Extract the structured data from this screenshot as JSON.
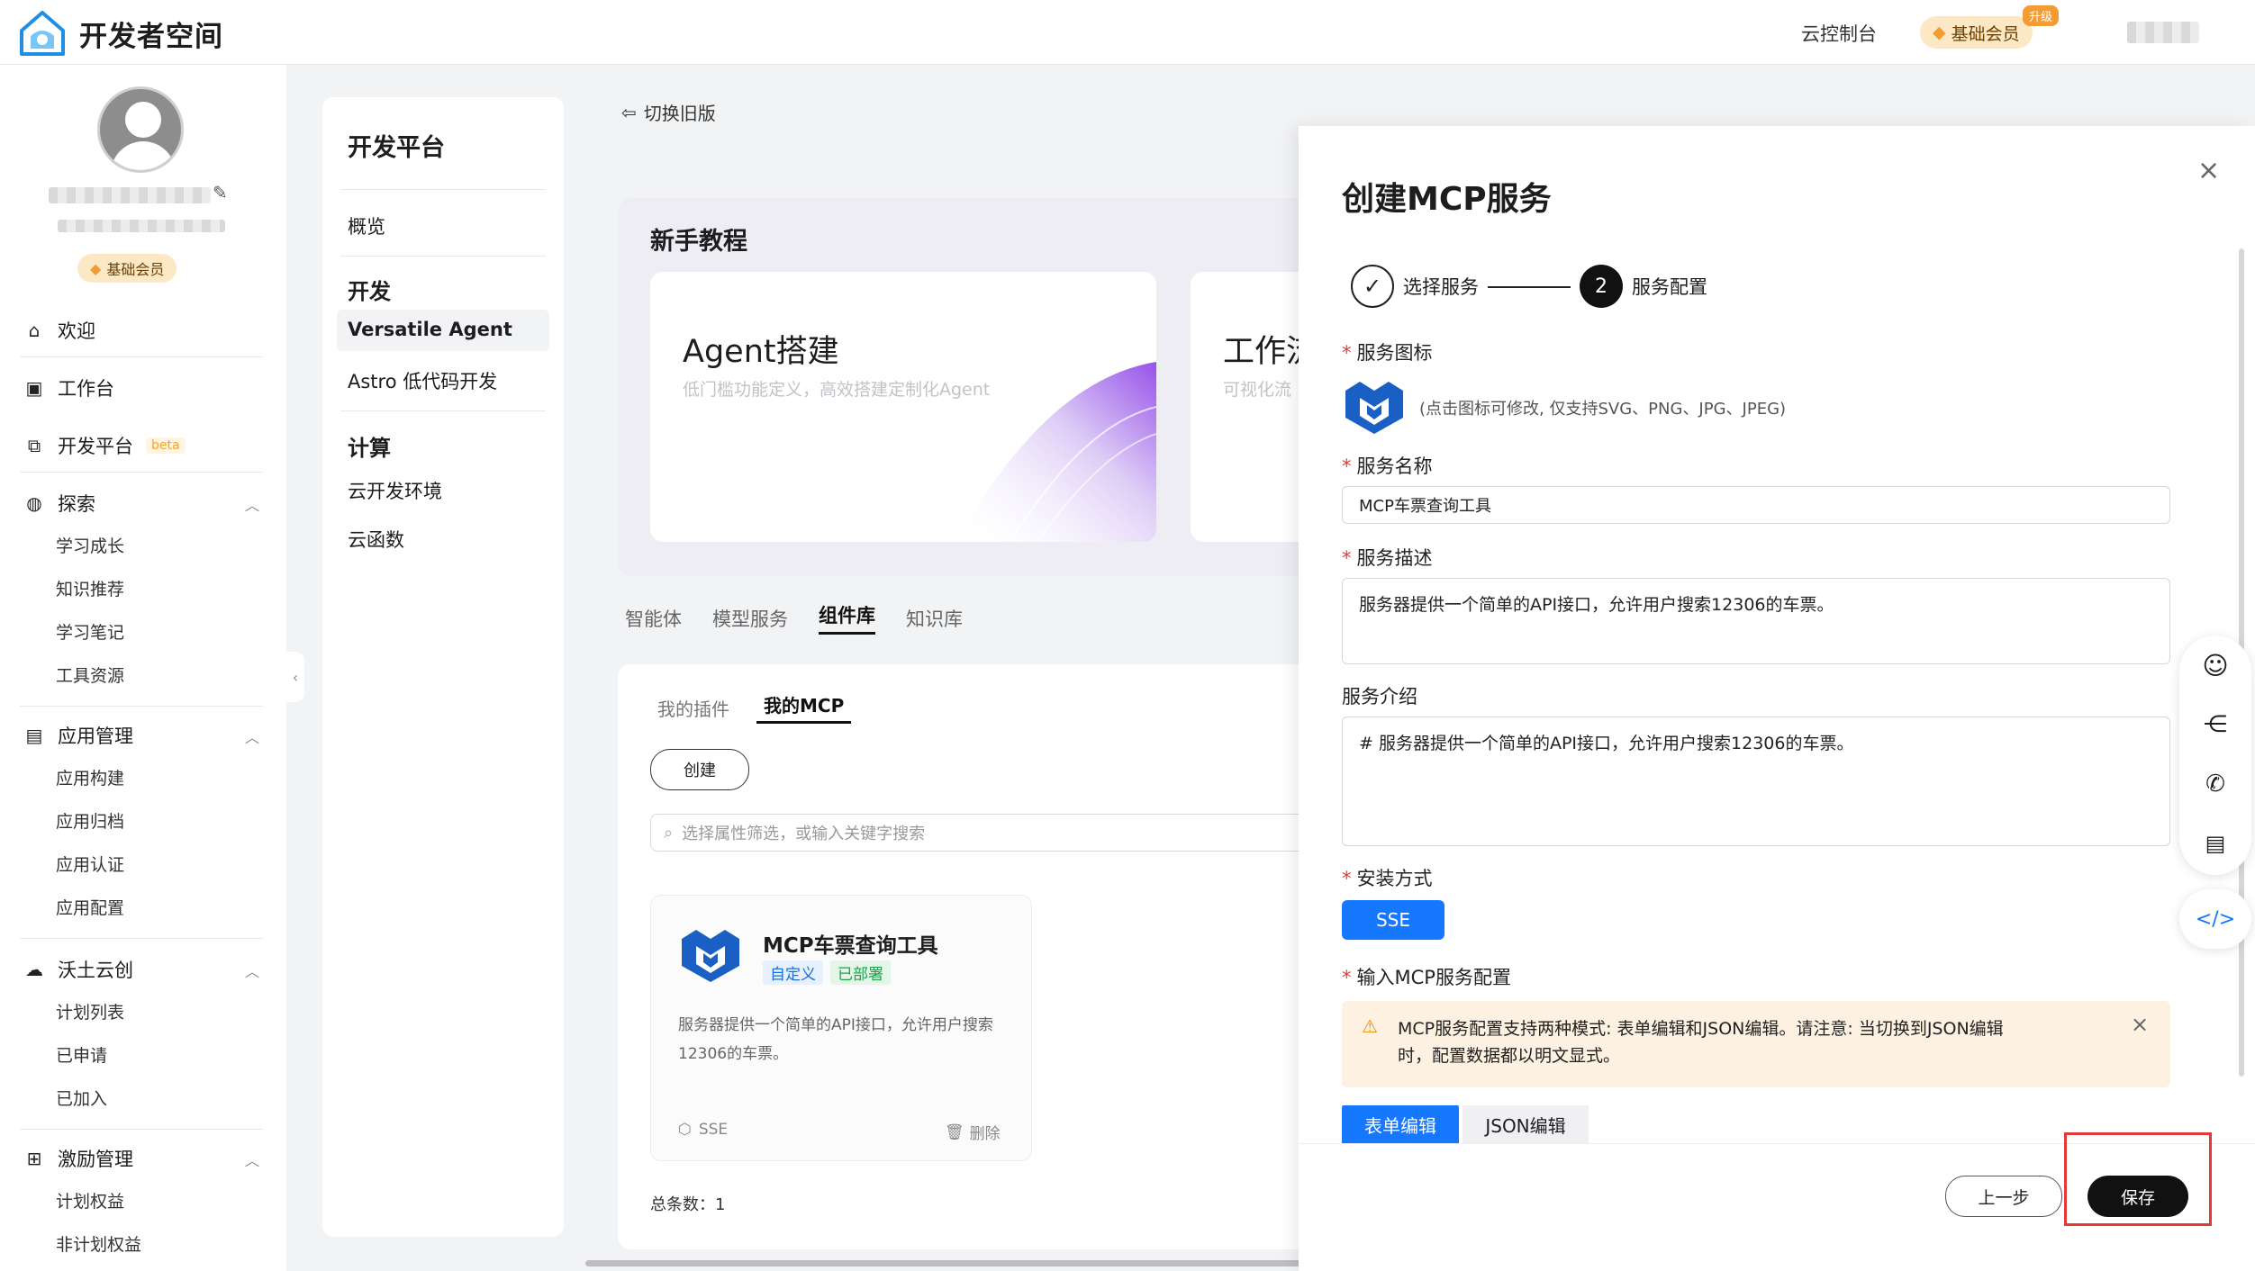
{
  "header": {
    "title": "开发者空间",
    "console_link": "云控制台",
    "member_label": "基础会员",
    "upgrade_badge": "升级"
  },
  "profile": {
    "member_label": "基础会员"
  },
  "sidebar": {
    "items": [
      {
        "label": "欢迎"
      },
      {
        "label": "工作台"
      },
      {
        "label": "开发平台",
        "badge": "beta"
      },
      {
        "label": "探索",
        "children": [
          "学习成长",
          "知识推荐",
          "学习笔记",
          "工具资源"
        ]
      },
      {
        "label": "应用管理",
        "children": [
          "应用构建",
          "应用归档",
          "应用认证",
          "应用配置"
        ]
      },
      {
        "label": "沃土云创",
        "children": [
          "计划列表",
          "已申请",
          "已加入"
        ]
      },
      {
        "label": "激励管理",
        "children": [
          "计划权益",
          "非计划权益"
        ]
      }
    ]
  },
  "panel2": {
    "title": "开发平台",
    "overview": "概览",
    "dev_section": "开发",
    "dev_items": [
      "Versatile Agent",
      "Astro 低代码开发"
    ],
    "compute_section": "计算",
    "compute_items": [
      "云开发环境",
      "云函数"
    ]
  },
  "main": {
    "switch_old": "切换旧版",
    "tutorial_title": "新手教程",
    "cards": [
      {
        "title": "Agent搭建",
        "desc": "低门槛功能定义，高效搭建定制化Agent"
      },
      {
        "title": "工作流",
        "desc": "可视化流"
      }
    ],
    "tabs": [
      "智能体",
      "模型服务",
      "组件库",
      "知识库"
    ],
    "active_tab": "组件库",
    "subtabs": [
      "我的插件",
      "我的MCP"
    ],
    "create_button": "创建",
    "search_placeholder": "选择属性筛选，或输入关键字搜索",
    "service_card": {
      "name": "MCP车票查询工具",
      "tag_custom": "自定义",
      "tag_deployed": "已部署",
      "desc": "服务器提供一个简单的API接口，允许用户搜索12306的车票。",
      "protocol": "SSE",
      "delete": "删除"
    },
    "total": "总条数：1"
  },
  "drawer": {
    "title": "创建MCP服务",
    "steps": [
      {
        "label": "选择服务",
        "status": "done"
      },
      {
        "number": "2",
        "label": "服务配置",
        "status": "active"
      }
    ],
    "icon_label": "服务图标",
    "icon_hint": "(点击图标可修改, 仅支持SVG、PNG、JPG、JPEG)",
    "name_label": "服务名称",
    "name_value": "MCP车票查询工具",
    "desc_label": "服务描述",
    "desc_value": "服务器提供一个简单的API接口，允许用户搜索12306的车票。",
    "intro_label": "服务介绍",
    "intro_value": "# 服务器提供一个简单的API接口，允许用户搜索12306的车票。",
    "install_label": "安装方式",
    "install_value": "SSE",
    "config_label": "输入MCP服务配置",
    "warning_line1": "MCP服务配置支持两种模式: 表单编辑和JSON编辑。请注意: 当切换到JSON编辑",
    "warning_line2": "时，配置数据都以明文显式。",
    "edit_tabs": [
      "表单编辑",
      "JSON编辑"
    ],
    "prev_button": "上一步",
    "save_button": "保存"
  },
  "colors": {
    "primary": "#1677ff",
    "brand_blue": "#1a6fd8",
    "highlight_red": "#e53935",
    "deployed_green": "#1aa34a"
  }
}
